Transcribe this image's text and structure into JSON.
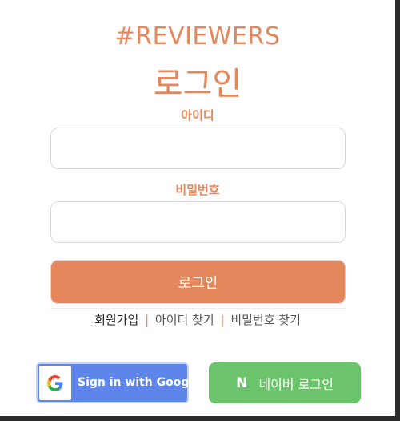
{
  "brand": "#REVIEWERS",
  "title": "로그인",
  "form": {
    "id_label": "아이디",
    "id_value": "",
    "pw_label": "비밀번호",
    "pw_value": "",
    "submit_label": "로그인"
  },
  "links": {
    "signup": "회원가입",
    "find_id": "아이디 찾기",
    "find_pw": "비밀번호 찾기",
    "separator": "|"
  },
  "social": {
    "google_label": "Sign in with Google",
    "google_icon": "google-g-icon",
    "naver_label": "네이버 로그인",
    "naver_icon_text": "N"
  },
  "colors": {
    "accent": "#e5875d",
    "google": "#5d85ea",
    "naver": "#6bc46b"
  }
}
